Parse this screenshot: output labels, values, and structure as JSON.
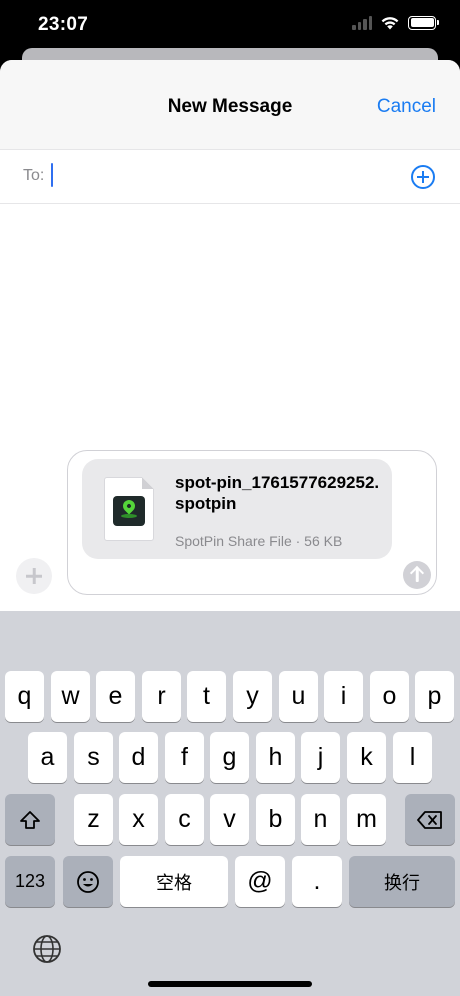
{
  "status": {
    "time": "23:07"
  },
  "header": {
    "title": "New Message",
    "cancel_label": "Cancel"
  },
  "to_field": {
    "label": "To:",
    "value": ""
  },
  "attachment": {
    "file_name": "spot-pin_1761577629252.spotpin",
    "meta": "SpotPin Share File · 56 KB",
    "icon": "spotpin-app-icon"
  },
  "keyboard": {
    "row1": [
      "q",
      "w",
      "e",
      "r",
      "t",
      "y",
      "u",
      "i",
      "o",
      "p"
    ],
    "row2": [
      "a",
      "s",
      "d",
      "f",
      "g",
      "h",
      "j",
      "k",
      "l"
    ],
    "row3": [
      "z",
      "x",
      "c",
      "v",
      "b",
      "n",
      "m"
    ],
    "numbers_label": "123",
    "space_label": "空格",
    "at_label": "@",
    "period_label": ".",
    "return_label": "换行",
    "shift_icon": "shift-icon",
    "delete_icon": "delete-icon",
    "emoji_icon": "emoji-icon",
    "globe_icon": "globe-icon"
  }
}
